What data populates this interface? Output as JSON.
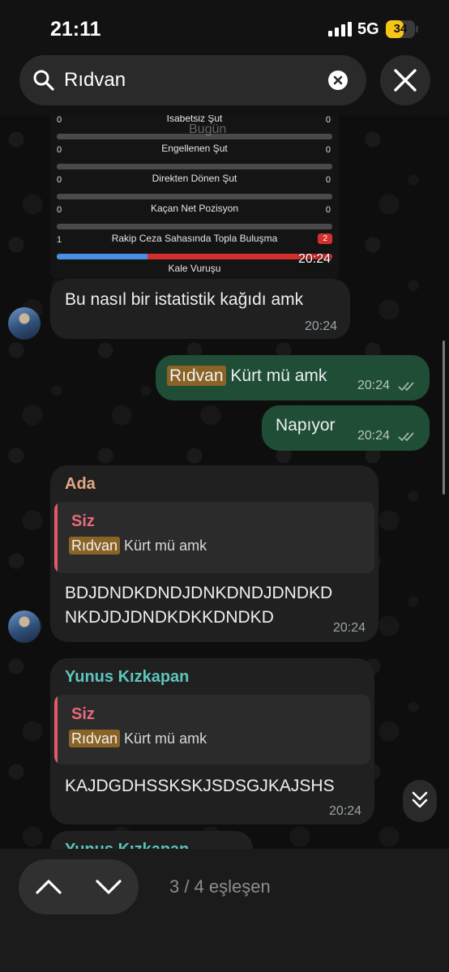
{
  "status_bar": {
    "time": "21:11",
    "network": "5G",
    "battery": "34",
    "battery_level": 0.34
  },
  "search": {
    "query": "Rıdvan"
  },
  "chat": {
    "date_label": "Bugün",
    "image_message": {
      "time": "20:24",
      "stats": [
        {
          "label": "İsabetsiz Şut",
          "left": "0",
          "right": "0"
        },
        {
          "label": "Engellenen Şut",
          "left": "0",
          "right": "0"
        },
        {
          "label": "Direkten Dönen Şut",
          "left": "0",
          "right": "0"
        },
        {
          "label": "Kaçan Net Pozisyon",
          "left": "0",
          "right": "0"
        },
        {
          "label": "Rakip Ceza Sahasında Topla Buluşma",
          "left": "1",
          "right": "2",
          "left_share": 0.33
        },
        {
          "label": "Kale Vuruşu"
        }
      ]
    },
    "messages": [
      {
        "text": "Bu nasıl bir istatistik kağıdı amk",
        "time": "20:24"
      },
      {
        "highlight": "Rıdvan",
        "text": " Kürt mü amk",
        "time": "20:24"
      },
      {
        "text": "Napıyor",
        "time": "20:24"
      },
      {
        "sender": "Ada",
        "sender_color": "#e0a887",
        "quote_sender": "Siz",
        "quote_highlight": "Rıdvan",
        "quote_text": " Kürt mü amk",
        "line1": "BDJDNDKDNDJDNKDNDJDNDKD",
        "line2": "NKDJDJDNDKDKKDNDKD",
        "time": "20:24"
      },
      {
        "sender": "Yunus Kızkapan",
        "sender_color": "#5cc6bd",
        "quote_sender": "Siz",
        "quote_highlight": "Rıdvan",
        "quote_text": " Kürt mü amk",
        "text": "KAJDGDHSSKSKJSDSGJKAJSHS",
        "time": "20:24"
      },
      {
        "sender": "Yunus Kızkapan"
      }
    ]
  },
  "footer": {
    "match_count": "3 / 4 eşleşen"
  }
}
